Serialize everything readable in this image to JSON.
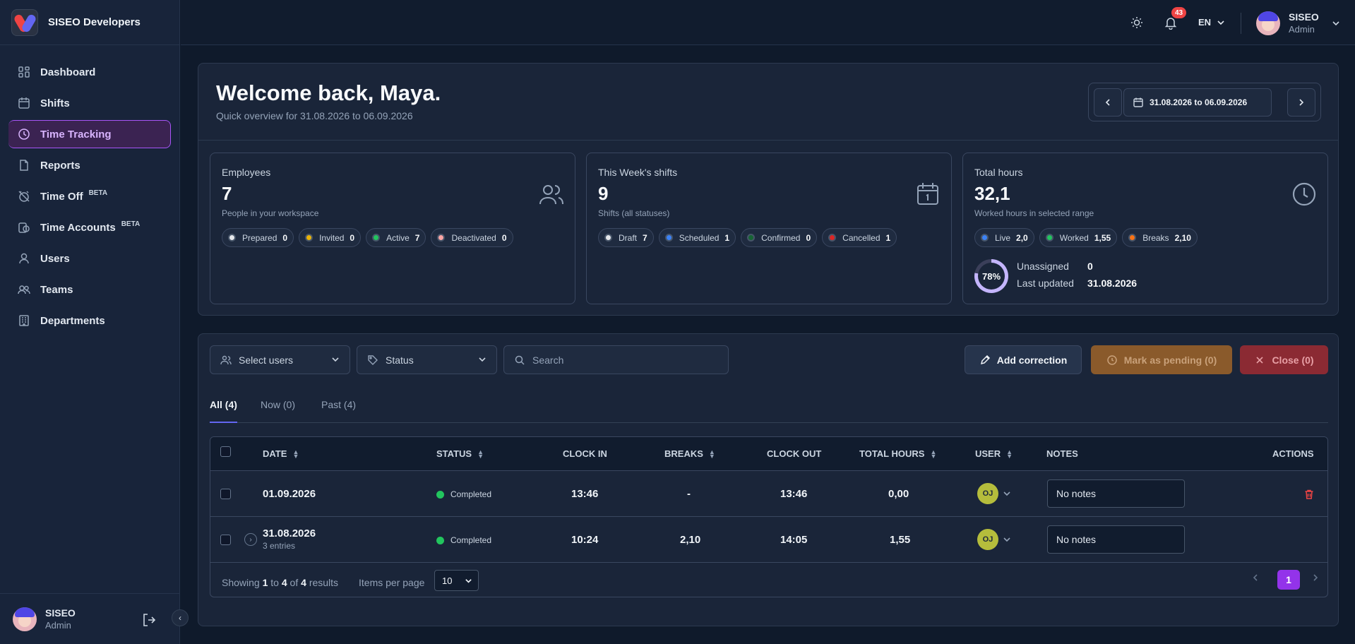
{
  "app": {
    "name": "SISEO Developers"
  },
  "sidebar": {
    "items": [
      {
        "label": "Dashboard",
        "icon": "grid-icon"
      },
      {
        "label": "Shifts",
        "icon": "calendar-icon"
      },
      {
        "label": "Time Tracking",
        "icon": "clock-icon",
        "active": true
      },
      {
        "label": "Reports",
        "icon": "document-icon"
      },
      {
        "label": "Time Off",
        "icon": "alarm-off-icon",
        "badge": "BETA"
      },
      {
        "label": "Time Accounts",
        "icon": "clock-account-icon",
        "badge": "BETA"
      },
      {
        "label": "Users",
        "icon": "user-icon"
      },
      {
        "label": "Teams",
        "icon": "users-icon"
      },
      {
        "label": "Departments",
        "icon": "building-icon"
      }
    ],
    "user": {
      "name": "SISEO",
      "role": "Admin"
    }
  },
  "topbar": {
    "notifications_count": "43",
    "language": "EN",
    "user": {
      "name": "SISEO",
      "role": "Admin"
    }
  },
  "overview": {
    "title": "Welcome back, Maya.",
    "subtitle": "Quick overview for 31.08.2026 to 06.09.2026",
    "date_range": "31.08.2026 to 06.09.2026"
  },
  "cards": {
    "employees": {
      "title": "Employees",
      "value": "7",
      "subtitle": "People in your workspace",
      "chips": [
        {
          "label": "Prepared",
          "count": "0",
          "color": "#e5e7eb"
        },
        {
          "label": "Invited",
          "count": "0",
          "color": "#eab308"
        },
        {
          "label": "Active",
          "count": "7",
          "color": "#22c55e"
        },
        {
          "label": "Deactivated",
          "count": "0",
          "color": "#fca5a5"
        }
      ]
    },
    "shifts": {
      "title": "This Week's shifts",
      "value": "9",
      "subtitle": "Shifts (all statuses)",
      "chips": [
        {
          "label": "Draft",
          "count": "7",
          "color": "#e5e7eb"
        },
        {
          "label": "Scheduled",
          "count": "1",
          "color": "#3b82f6"
        },
        {
          "label": "Confirmed",
          "count": "0",
          "color": "#166534"
        },
        {
          "label": "Cancelled",
          "count": "1",
          "color": "#dc2626"
        }
      ]
    },
    "hours": {
      "title": "Total hours",
      "value": "32,1",
      "subtitle": "Worked hours in selected range",
      "chips": [
        {
          "label": "Live",
          "count": "2,0",
          "color": "#3b82f6"
        },
        {
          "label": "Worked",
          "count": "1,55",
          "color": "#22c55e"
        },
        {
          "label": "Breaks",
          "count": "2,10",
          "color": "#f97316"
        }
      ],
      "progress_label": "78%",
      "progress": 0.78,
      "unassigned_label": "Unassigned",
      "unassigned_value": "0",
      "updated_label": "Last updated",
      "updated_value": "31.08.2026"
    }
  },
  "filters": {
    "users_placeholder": "Select users",
    "status_placeholder": "Status",
    "search_placeholder": "Search"
  },
  "actions": {
    "add_correction": "Add correction",
    "mark_pending": "Mark as pending (0)",
    "close": "Close (0)"
  },
  "tabs": [
    {
      "label": "All (4)",
      "active": true
    },
    {
      "label": "Now (0)"
    },
    {
      "label": "Past (4)"
    }
  ],
  "table": {
    "columns": {
      "date": "DATE",
      "status": "STATUS",
      "clock_in": "CLOCK IN",
      "breaks": "BREAKS",
      "clock_out": "CLOCK OUT",
      "total": "TOTAL HOURS",
      "user": "USER",
      "notes": "NOTES",
      "actions": "ACTIONS"
    },
    "rows": [
      {
        "date": "01.09.2026",
        "entries": "",
        "status": "Completed",
        "clock_in": "13:46",
        "breaks": "-",
        "clock_out": "13:46",
        "total": "0,00",
        "user": "OJ",
        "notes": "No notes"
      },
      {
        "date": "31.08.2026",
        "entries": "3 entries",
        "status": "Completed",
        "clock_in": "10:24",
        "breaks": "2,10",
        "clock_out": "14:05",
        "total": "1,55",
        "user": "OJ",
        "notes": "No notes"
      }
    ]
  },
  "pagination": {
    "showing": "Showing",
    "from": "1",
    "to_word": "to",
    "to": "4",
    "of_word": "of",
    "total": "4",
    "results": "results",
    "items_per_page_label": "Items per page",
    "items_per_page": "10",
    "current_page": "1"
  },
  "colors": {
    "accent": "#9333ea",
    "pending": "#a16207",
    "danger": "#b91c1c"
  }
}
